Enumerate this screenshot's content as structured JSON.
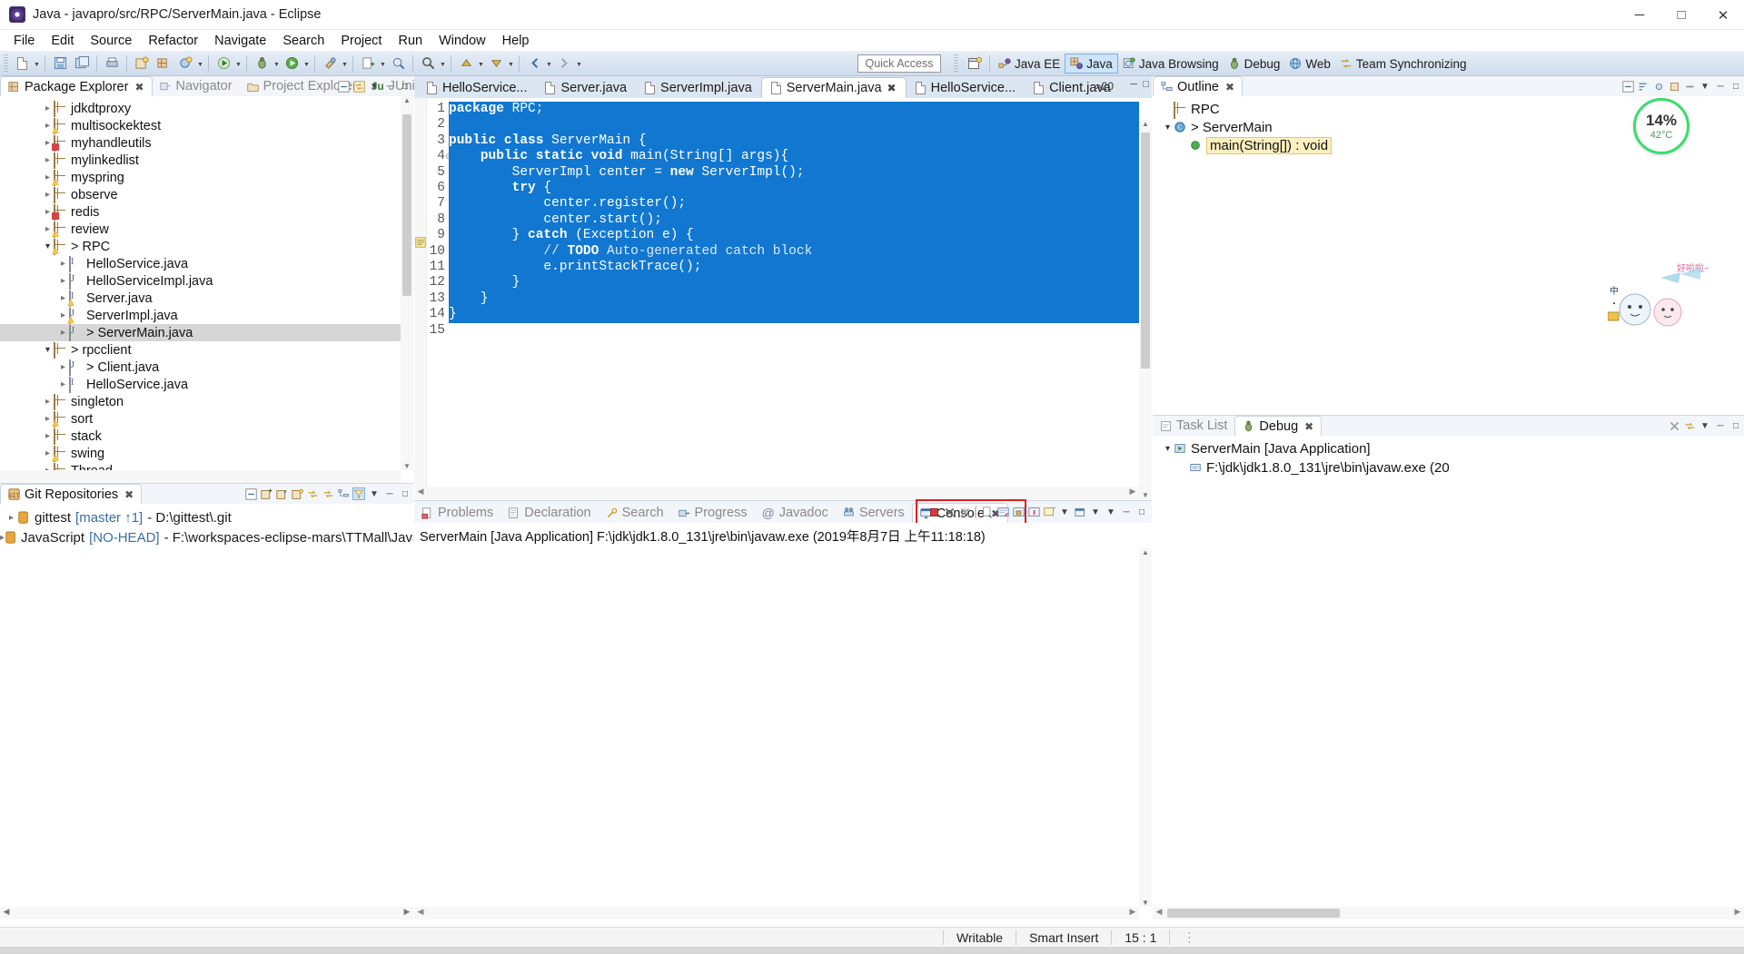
{
  "window": {
    "title": "Java - javapro/src/RPC/ServerMain.java - Eclipse",
    "minimize": "─",
    "maximize": "□",
    "close": "✕"
  },
  "menubar": [
    {
      "label": "File",
      "mnemonic": "F"
    },
    {
      "label": "Edit",
      "mnemonic": "E"
    },
    {
      "label": "Source",
      "mnemonic": "S"
    },
    {
      "label": "Refactor",
      "mnemonic": "t"
    },
    {
      "label": "Navigate",
      "mnemonic": "N"
    },
    {
      "label": "Search",
      "mnemonic": "a"
    },
    {
      "label": "Project",
      "mnemonic": "P"
    },
    {
      "label": "Run",
      "mnemonic": "R"
    },
    {
      "label": "Window",
      "mnemonic": "W"
    },
    {
      "label": "Help",
      "mnemonic": "H"
    }
  ],
  "toolbar": {
    "quick_access_placeholder": "Quick Access",
    "perspectives": [
      {
        "label": "Java EE",
        "icon": "java-ee-perspective-icon",
        "active": false
      },
      {
        "label": "Java",
        "icon": "java-perspective-icon",
        "active": true
      },
      {
        "label": "Java Browsing",
        "icon": "java-browsing-perspective-icon",
        "active": false
      },
      {
        "label": "Debug",
        "icon": "debug-perspective-icon",
        "active": false
      },
      {
        "label": "Web",
        "icon": "web-perspective-icon",
        "active": false
      },
      {
        "label": "Team Synchronizing",
        "icon": "team-sync-perspective-icon",
        "active": false
      }
    ],
    "open_perspective_icon": "open-perspective-icon"
  },
  "package_explorer": {
    "tabs": [
      {
        "label": "Package Explorer",
        "icon": "package-explorer-icon",
        "active": true,
        "closable": true
      },
      {
        "label": "Navigator",
        "icon": "navigator-icon",
        "active": false
      },
      {
        "label": "Project Explorer",
        "icon": "project-explorer-icon",
        "active": false
      },
      {
        "label": "JUnit",
        "icon": "junit-icon",
        "active": false
      }
    ],
    "tree": [
      {
        "label": "jdkdtproxy",
        "indent": 1,
        "arrow": "collapsed",
        "icon": "package-icon",
        "overlay": "none"
      },
      {
        "label": "multisockektest",
        "indent": 1,
        "arrow": "collapsed",
        "icon": "package-icon",
        "overlay": "warning"
      },
      {
        "label": "myhandleutils",
        "indent": 1,
        "arrow": "collapsed",
        "icon": "package-icon",
        "overlay": "error"
      },
      {
        "label": "mylinkedlist",
        "indent": 1,
        "arrow": "collapsed",
        "icon": "package-icon",
        "overlay": "none"
      },
      {
        "label": "myspring",
        "indent": 1,
        "arrow": "collapsed",
        "icon": "package-icon",
        "overlay": "warning"
      },
      {
        "label": "observe",
        "indent": 1,
        "arrow": "collapsed",
        "icon": "package-icon",
        "overlay": "none"
      },
      {
        "label": "redis",
        "indent": 1,
        "arrow": "collapsed",
        "icon": "package-icon",
        "overlay": "error"
      },
      {
        "label": "review",
        "indent": 1,
        "arrow": "collapsed",
        "icon": "package-icon",
        "overlay": "warning"
      },
      {
        "label": "> RPC",
        "indent": 1,
        "arrow": "expanded",
        "icon": "package-icon",
        "overlay": "warning"
      },
      {
        "label": "HelloService.java",
        "indent": 2,
        "arrow": "collapsed",
        "icon": "interface-file-icon",
        "overlay": "none"
      },
      {
        "label": "HelloServiceImpl.java",
        "indent": 2,
        "arrow": "collapsed",
        "icon": "class-file-icon",
        "overlay": "none"
      },
      {
        "label": "Server.java",
        "indent": 2,
        "arrow": "collapsed",
        "icon": "interface-file-icon",
        "overlay": "warning"
      },
      {
        "label": "ServerImpl.java",
        "indent": 2,
        "arrow": "collapsed",
        "icon": "class-file-icon",
        "overlay": "warning"
      },
      {
        "label": "> ServerMain.java",
        "indent": 2,
        "arrow": "collapsed",
        "icon": "class-file-icon",
        "overlay": "none",
        "selected": true
      },
      {
        "label": "> rpcclient",
        "indent": 1,
        "arrow": "expanded",
        "icon": "package-icon",
        "overlay": "none"
      },
      {
        "label": "> Client.java",
        "indent": 2,
        "arrow": "collapsed",
        "icon": "class-file-icon",
        "overlay": "none"
      },
      {
        "label": "HelloService.java",
        "indent": 2,
        "arrow": "collapsed",
        "icon": "interface-file-icon",
        "overlay": "none"
      },
      {
        "label": "singleton",
        "indent": 1,
        "arrow": "collapsed",
        "icon": "package-icon",
        "overlay": "none"
      },
      {
        "label": "sort",
        "indent": 1,
        "arrow": "collapsed",
        "icon": "package-icon",
        "overlay": "warning"
      },
      {
        "label": "stack",
        "indent": 1,
        "arrow": "collapsed",
        "icon": "package-icon",
        "overlay": "none"
      },
      {
        "label": "swing",
        "indent": 1,
        "arrow": "collapsed",
        "icon": "package-icon",
        "overlay": "warning"
      },
      {
        "label": "Thread",
        "indent": 1,
        "arrow": "collapsed",
        "icon": "package-icon",
        "overlay": "none"
      }
    ]
  },
  "git_repositories": {
    "tab_label": "Git Repositories",
    "tab_icon": "git-repositories-icon",
    "rows": [
      {
        "arrow": "collapsed",
        "name": "gittest",
        "branch": "[master ↑1]",
        "path": "- D:\\gittest\\.git"
      },
      {
        "arrow": "collapsed",
        "name": "JavaScript",
        "branch": "[NO-HEAD]",
        "path": "- F:\\workspaces-eclipse-mars\\TTMall\\JavaScript"
      }
    ]
  },
  "editor": {
    "tabs": [
      {
        "label": "HelloService...",
        "icon": "java-file-icon",
        "active": false,
        "closable": false
      },
      {
        "label": "Server.java",
        "icon": "java-file-warning-icon",
        "active": false,
        "closable": false
      },
      {
        "label": "ServerImpl.java",
        "icon": "java-file-warning-icon",
        "active": false,
        "closable": false
      },
      {
        "label": "ServerMain.java",
        "icon": "java-file-icon",
        "active": true,
        "closable": true
      },
      {
        "label": "HelloService...",
        "icon": "java-file-icon",
        "active": false,
        "closable": false
      },
      {
        "label": "Client.java",
        "icon": "java-file-icon",
        "active": false,
        "closable": false
      }
    ],
    "overflow_label": "»20",
    "selection_color": "#1177d1",
    "lines": [
      {
        "n": 1,
        "fold": false,
        "marker": "none",
        "selected": true,
        "tokens": [
          {
            "t": "package",
            "c": "kw"
          },
          {
            "t": " RPC;",
            "c": "sel"
          }
        ]
      },
      {
        "n": 2,
        "fold": false,
        "marker": "none",
        "selected": true,
        "tokens": [
          {
            "t": "",
            "c": "sel"
          }
        ]
      },
      {
        "n": 3,
        "fold": false,
        "marker": "none",
        "selected": true,
        "tokens": [
          {
            "t": "public class",
            "c": "kw"
          },
          {
            "t": " ServerMain {",
            "c": "sel"
          }
        ]
      },
      {
        "n": 4,
        "fold": true,
        "marker": "none",
        "selected": true,
        "tokens": [
          {
            "t": "    ",
            "c": "sel"
          },
          {
            "t": "public static void",
            "c": "kw"
          },
          {
            "t": " main(String[] args){",
            "c": "sel"
          }
        ]
      },
      {
        "n": 5,
        "fold": false,
        "marker": "none",
        "selected": true,
        "tokens": [
          {
            "t": "        ServerImpl center = ",
            "c": "sel"
          },
          {
            "t": "new",
            "c": "kw"
          },
          {
            "t": " ServerImpl();",
            "c": "sel"
          }
        ]
      },
      {
        "n": 6,
        "fold": false,
        "marker": "none",
        "selected": true,
        "tokens": [
          {
            "t": "        ",
            "c": "sel"
          },
          {
            "t": "try",
            "c": "kw"
          },
          {
            "t": " {",
            "c": "sel"
          }
        ]
      },
      {
        "n": 7,
        "fold": false,
        "marker": "none",
        "selected": true,
        "tokens": [
          {
            "t": "            center.register();",
            "c": "sel"
          }
        ]
      },
      {
        "n": 8,
        "fold": false,
        "marker": "none",
        "selected": true,
        "tokens": [
          {
            "t": "            center.start();",
            "c": "sel"
          }
        ]
      },
      {
        "n": 9,
        "fold": false,
        "marker": "none",
        "selected": true,
        "tokens": [
          {
            "t": "        } ",
            "c": "sel"
          },
          {
            "t": "catch",
            "c": "kw"
          },
          {
            "t": " (Exception e) {",
            "c": "sel"
          }
        ]
      },
      {
        "n": 10,
        "fold": false,
        "marker": "todo",
        "selected": true,
        "tokens": [
          {
            "t": "            // ",
            "c": "comment"
          },
          {
            "t": "TODO",
            "c": "todo"
          },
          {
            "t": " Auto-generated catch block",
            "c": "comment"
          }
        ]
      },
      {
        "n": 11,
        "fold": false,
        "marker": "none",
        "selected": true,
        "tokens": [
          {
            "t": "            e.printStackTrace();",
            "c": "sel"
          }
        ]
      },
      {
        "n": 12,
        "fold": false,
        "marker": "none",
        "selected": true,
        "tokens": [
          {
            "t": "        }",
            "c": "sel"
          }
        ]
      },
      {
        "n": 13,
        "fold": false,
        "marker": "none",
        "selected": true,
        "tokens": [
          {
            "t": "    }",
            "c": "sel"
          }
        ]
      },
      {
        "n": 14,
        "fold": false,
        "marker": "none",
        "selected": true,
        "tokens": [
          {
            "t": "}",
            "c": "sel"
          }
        ]
      },
      {
        "n": 15,
        "fold": false,
        "marker": "none",
        "selected": false,
        "tokens": [
          {
            "t": "",
            "c": "plain"
          }
        ]
      }
    ]
  },
  "outline": {
    "tab_label": "Outline",
    "tab_icon": "outline-icon",
    "rows": [
      {
        "indent": 1,
        "arrow": "none",
        "icon": "package-decl-icon",
        "label": "RPC"
      },
      {
        "indent": 1,
        "arrow": "expanded",
        "icon": "class-icon",
        "label": "> ServerMain"
      },
      {
        "indent": 2,
        "arrow": "none",
        "icon": "method-icon",
        "label": "main(String[]) : void",
        "highlighted": true
      }
    ],
    "cpu_badge": {
      "percent": "14%",
      "temp": "42°C"
    },
    "mascot_text": "好噢噢~"
  },
  "debug_view": {
    "tabs": [
      {
        "label": "Task List",
        "icon": "task-list-icon",
        "active": false
      },
      {
        "label": "Debug",
        "icon": "debug-icon",
        "active": true,
        "closable": true
      }
    ],
    "rows": [
      {
        "indent": 0,
        "arrow": "expanded",
        "icon": "launch-icon",
        "label": "ServerMain [Java Application]"
      },
      {
        "indent": 1,
        "arrow": "none",
        "icon": "jvm-icon",
        "label": "F:\\jdk\\jdk1.8.0_131\\jre\\bin\\javaw.exe (20"
      }
    ]
  },
  "bottom_panel": {
    "tabs": [
      {
        "label": "Problems",
        "icon": "problems-icon",
        "active": false
      },
      {
        "label": "Declaration",
        "icon": "declaration-icon",
        "active": false
      },
      {
        "label": "Search",
        "icon": "search-icon",
        "active": false
      },
      {
        "label": "Progress",
        "icon": "progress-icon",
        "active": false
      },
      {
        "label": "Javadoc",
        "icon": "javadoc-icon",
        "active": false
      },
      {
        "label": "Servers",
        "icon": "servers-icon",
        "active": false
      },
      {
        "label": "Console",
        "icon": "console-icon",
        "active": true,
        "closable": true
      }
    ],
    "console_header": "ServerMain [Java Application] F:\\jdk\\jdk1.8.0_131\\jre\\bin\\javaw.exe (2019年8月7日 上午11:18:18)",
    "console_body": "",
    "highlight_color": "#e02020",
    "toolbar_icons": [
      {
        "name": "terminate-icon",
        "glyph": "stop"
      },
      {
        "name": "terminate-all-icon",
        "glyph": "x"
      },
      {
        "name": "remove-launch-icon",
        "glyph": "xx"
      },
      {
        "name": "remove-all-launches-icon",
        "glyph": "pages"
      },
      {
        "name": "clear-console-icon",
        "glyph": "clear"
      },
      {
        "name": "scroll-lock-icon",
        "glyph": "lock"
      },
      {
        "name": "show-console-icon",
        "glyph": "console"
      },
      {
        "name": "pin-console-icon",
        "glyph": "pin"
      },
      {
        "name": "display-console-icon",
        "glyph": "display"
      },
      {
        "name": "open-console-icon",
        "glyph": "open"
      }
    ]
  },
  "statusbar": {
    "writable": "Writable",
    "insert_mode": "Smart Insert",
    "position": "15 : 1"
  }
}
